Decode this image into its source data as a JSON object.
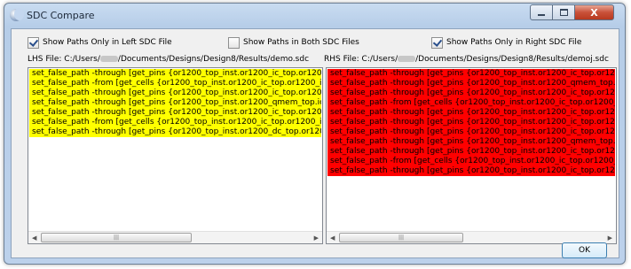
{
  "window": {
    "title": "SDC Compare",
    "close_glyph": "X"
  },
  "checkboxes": [
    {
      "label": "Show Paths Only in Left SDC File",
      "checked": true
    },
    {
      "label": "Show Paths in Both SDC Files",
      "checked": false
    },
    {
      "label": "Show Paths Only in Right SDC File",
      "checked": true
    }
  ],
  "lhs": {
    "label_prefix": "LHS File: C:/Users/",
    "label_suffix": "/Documents/Designs/Design8/Results/demo.sdc",
    "highlight_color": "#ffff00",
    "lines": [
      "set_false_path -through [get_pins {or1200_top_inst.or1200_ic_top.or1200_ic",
      "set_false_path -from [get_cells {or1200_top_inst.or1200_ic_top.or1200_ic_fs",
      "set_false_path -through [get_pins {or1200_top_inst.or1200_ic_top.or1200_ic",
      "set_false_path -through [get_pins {or1200_top_inst.or1200_qmem_top.icqm",
      "set_false_path -through [get_pins {or1200_top_inst.or1200_ic_top.or1200_ic",
      "set_false_path -from [get_cells {or1200_top_inst.or1200_ic_top.or1200_ic_fs",
      "set_false_path -through [get_pins {or1200_top_inst.or1200_dc_top.or1200_dc"
    ]
  },
  "rhs": {
    "label_prefix": "RHS File: C:/Users/",
    "label_suffix": "/Documents/Designs/Design8/Results/demoj.sdc",
    "highlight_color": "#ff0000",
    "lines": [
      "set_false_path -through [get_pins {or1200_top_inst.or1200_ic_top.or1200_ic",
      "set_false_path -through [get_pins {or1200_top_inst.or1200_qmem_top.icqm",
      "set_false_path -through [get_pins {or1200_top_inst.or1200_ic_top.or1200_ic",
      "set_false_path -from [get_cells {or1200_top_inst.or1200_ic_top.or1200_ic_fs",
      "set_false_path -through [get_pins {or1200_top_inst.or1200_ic_top.or1200_ic",
      "set_false_path -through [get_pins {or1200_top_inst.or1200_ic_top.or1200_ic",
      "set_false_path -through [get_pins {or1200_top_inst.or1200_ic_top.or1200_ic",
      "set_false_path -through [get_pins {or1200_top_inst.or1200_qmem_top.icqm",
      "set_false_path -through [get_pins {or1200_top_inst.or1200_ic_top.or1200_ic",
      "set_false_path -from [get_cells {or1200_top_inst.or1200_ic_top.or1200_ic_fs",
      "set_false_path -through [get_pins {or1200_top_inst.or1200_ic_top.or1200_ic"
    ]
  },
  "scrollbar": {
    "left_arrow": "◀",
    "right_arrow": "▶",
    "grip": "|||"
  },
  "ok_button": "OK"
}
